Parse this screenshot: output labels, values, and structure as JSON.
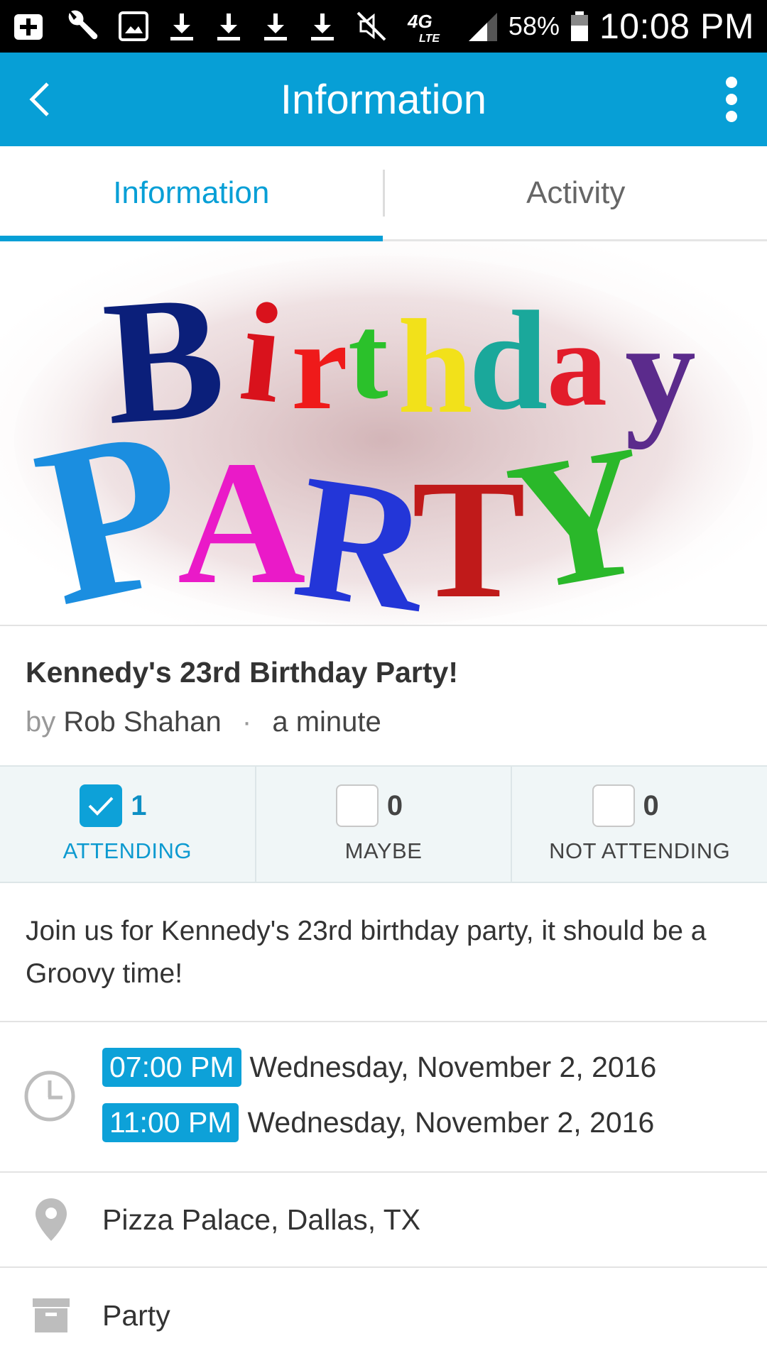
{
  "status_bar": {
    "network": "4G LTE",
    "battery": "58%",
    "time": "10:08 PM"
  },
  "app_bar": {
    "title": "Information",
    "icons": [
      "back-arrow-icon",
      "more-vert-icon"
    ],
    "color": "#079fd6"
  },
  "tabs": [
    {
      "label": "Information",
      "active": true
    },
    {
      "label": "Activity",
      "active": false
    }
  ],
  "hero_image": {
    "line1": "Birthday",
    "line2": "PARTY"
  },
  "event": {
    "title": "Kennedy's 23rd Birthday Party!",
    "by_label": "by",
    "author": "Rob Shahan",
    "separator": "·",
    "time_ago": "a minute"
  },
  "rsvp": [
    {
      "count": "1",
      "label": "ATTENDING",
      "checked": true
    },
    {
      "count": "0",
      "label": "MAYBE",
      "checked": false
    },
    {
      "count": "0",
      "label": "NOT ATTENDING",
      "checked": false
    }
  ],
  "description": "Join us for Kennedy's 23rd birthday party, it should be a Groovy time!",
  "schedule": {
    "start_time": "07:00 PM",
    "start_date": "Wednesday, November 2, 2016",
    "end_time": "11:00 PM",
    "end_date": "Wednesday, November 2, 2016"
  },
  "location": "Pizza Palace, Dallas, TX",
  "category": "Party",
  "colors": {
    "accent": "#079fd6",
    "badge": "#0da1d8"
  }
}
